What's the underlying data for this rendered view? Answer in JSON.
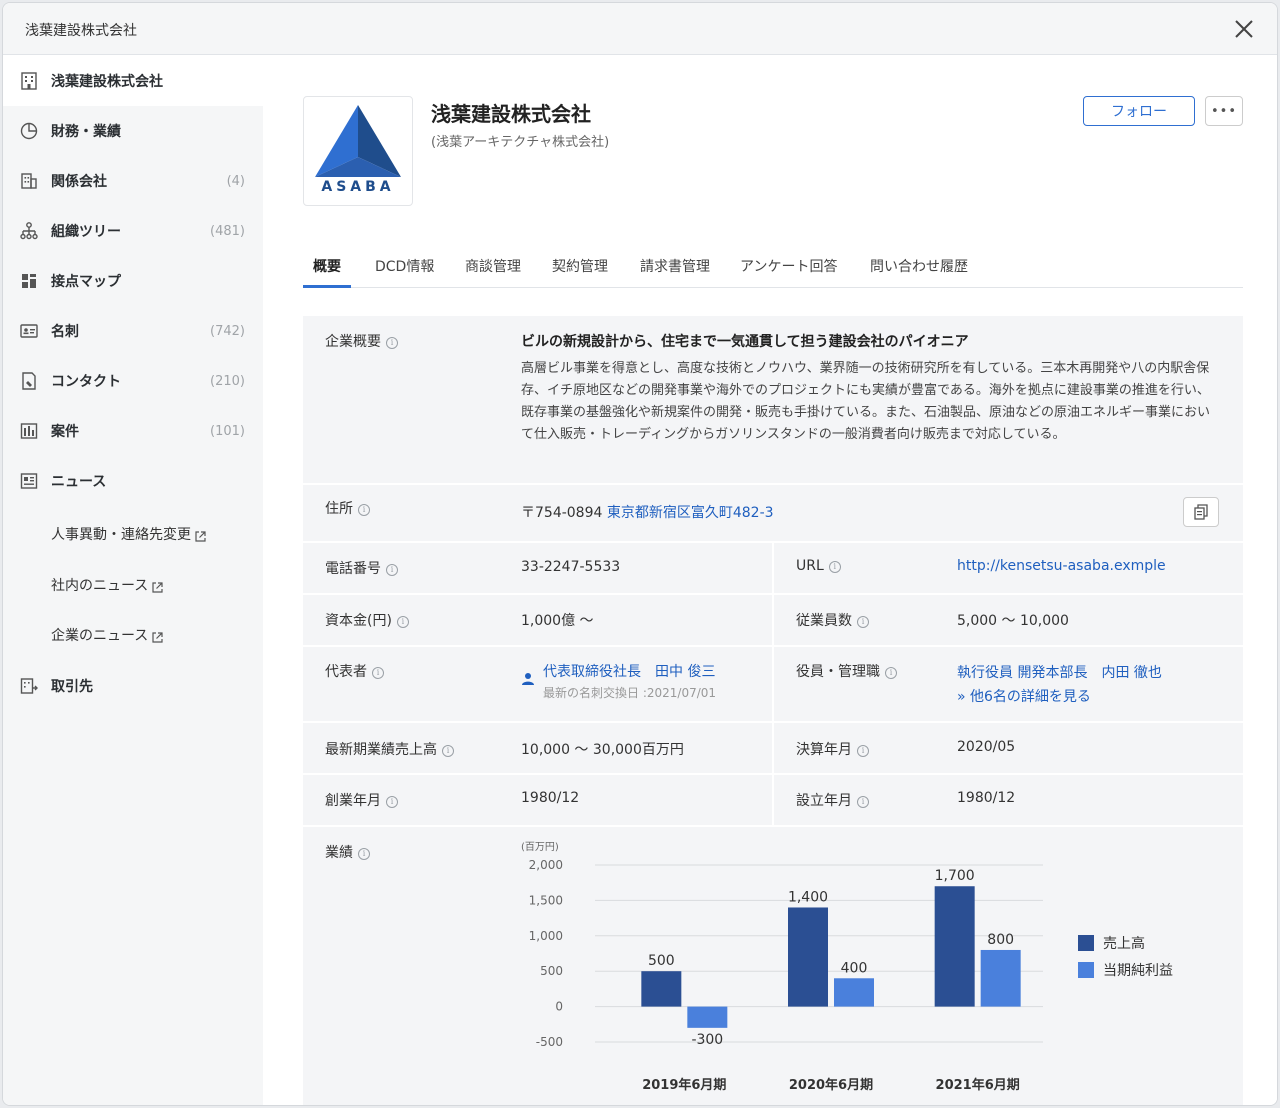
{
  "window": {
    "title": "浅葉建設株式会社"
  },
  "sidebar": {
    "items": [
      {
        "label": "浅葉建設株式会社",
        "count": "",
        "icon": "building-icon"
      },
      {
        "label": "財務・業績",
        "count": "",
        "icon": "pie-chart-icon"
      },
      {
        "label": "関係会社",
        "count": "(4)",
        "icon": "related-companies-icon"
      },
      {
        "label": "組織ツリー",
        "count": "(481)",
        "icon": "org-tree-icon"
      },
      {
        "label": "接点マップ",
        "count": "",
        "icon": "grid-map-icon"
      },
      {
        "label": "名刺",
        "count": "(742)",
        "icon": "business-card-icon"
      },
      {
        "label": "コンタクト",
        "count": "(210)",
        "icon": "contact-icon"
      },
      {
        "label": "案件",
        "count": "(101)",
        "icon": "deal-icon"
      },
      {
        "label": "ニュース",
        "count": "",
        "icon": "news-icon"
      },
      {
        "label": "取引先",
        "count": "",
        "icon": "client-icon"
      }
    ],
    "news_sub": [
      "人事異動・連絡先変更",
      "社内のニュース",
      "企業のニュース"
    ]
  },
  "company": {
    "logo_text": "ASABA",
    "name": "浅葉建設株式会社",
    "sub_name": "(浅葉アーキテクチャ株式会社)",
    "follow_label": "フォロー",
    "more_label": "•••"
  },
  "tabs": [
    "概要",
    "DCD情報",
    "商談管理",
    "契約管理",
    "請求書管理",
    "アンケート回答",
    "問い合わせ履歴"
  ],
  "overview": {
    "summary_label": "企業概要",
    "summary_title": "ビルの新規設計から、住宅まで一気通貫して担う建設会社のパイオニア",
    "summary_body": "高層ビル事業を得意とし、高度な技術とノウハウ、業界随一の技術研究所を有している。三本木再開発や八の内駅舎保存、イチ原地区などの開発事業や海外でのプロジェクトにも実績が豊富である。海外を拠点に建設事業の推進を行い、既存事業の基盤強化や新規案件の開発・販売も手掛けている。また、石油製品、原油などの原油エネルギー事業において仕入販売・トレーディングからガソリンスタンドの一般消費者向け販売まで対応している。",
    "address_label": "住所",
    "postal": "〒754-0894",
    "address": "東京都新宿区富久町482-3",
    "phone_label": "電話番号",
    "phone": "33-2247-5533",
    "url_label": "URL",
    "url": "http://kensetsu-asaba.exmple",
    "capital_label": "資本金(円)",
    "capital": "1,000億 ～",
    "employees_label": "従業員数",
    "employees": "5,000 ～ 10,000",
    "rep_label": "代表者",
    "rep": "代表取締役社長　田中 俊三",
    "rep_sub": "最新の名刺交換日 :2021/07/01",
    "officers_label": "役員・管理職",
    "officer": "執行役員 開発本部長　内田 徹也",
    "officers_more": "» 他6名の詳細を見る",
    "sales_label": "最新期業績売上高",
    "sales": "10,000 ～ 30,000百万円",
    "fiscal_label": "決算年月",
    "fiscal": "2020/05",
    "founded_label": "創業年月",
    "founded": "1980/12",
    "established_label": "設立年月",
    "established": "1980/12",
    "performance_label": "業績"
  },
  "chart_data": {
    "type": "bar",
    "unit_label": "(百万円)",
    "categories": [
      "2019年6月期",
      "2020年6月期",
      "2021年6月期"
    ],
    "series": [
      {
        "name": "売上高",
        "values": [
          500,
          1400,
          1700
        ],
        "color": "#2b4f93"
      },
      {
        "name": "当期純利益",
        "values": [
          -300,
          400,
          800
        ],
        "color": "#4a80dc"
      }
    ],
    "yticks": [
      2000,
      1500,
      1000,
      500,
      0,
      -500
    ],
    "ytick_labels": [
      "2,000",
      "1,500",
      "1,000",
      "500",
      "0",
      "-500"
    ],
    "data_labels": [
      [
        "500",
        "1,400",
        "1,700"
      ],
      [
        "-300",
        "400",
        "800"
      ]
    ],
    "ylim": [
      -500,
      2000
    ],
    "grid": true,
    "legend": "right"
  }
}
